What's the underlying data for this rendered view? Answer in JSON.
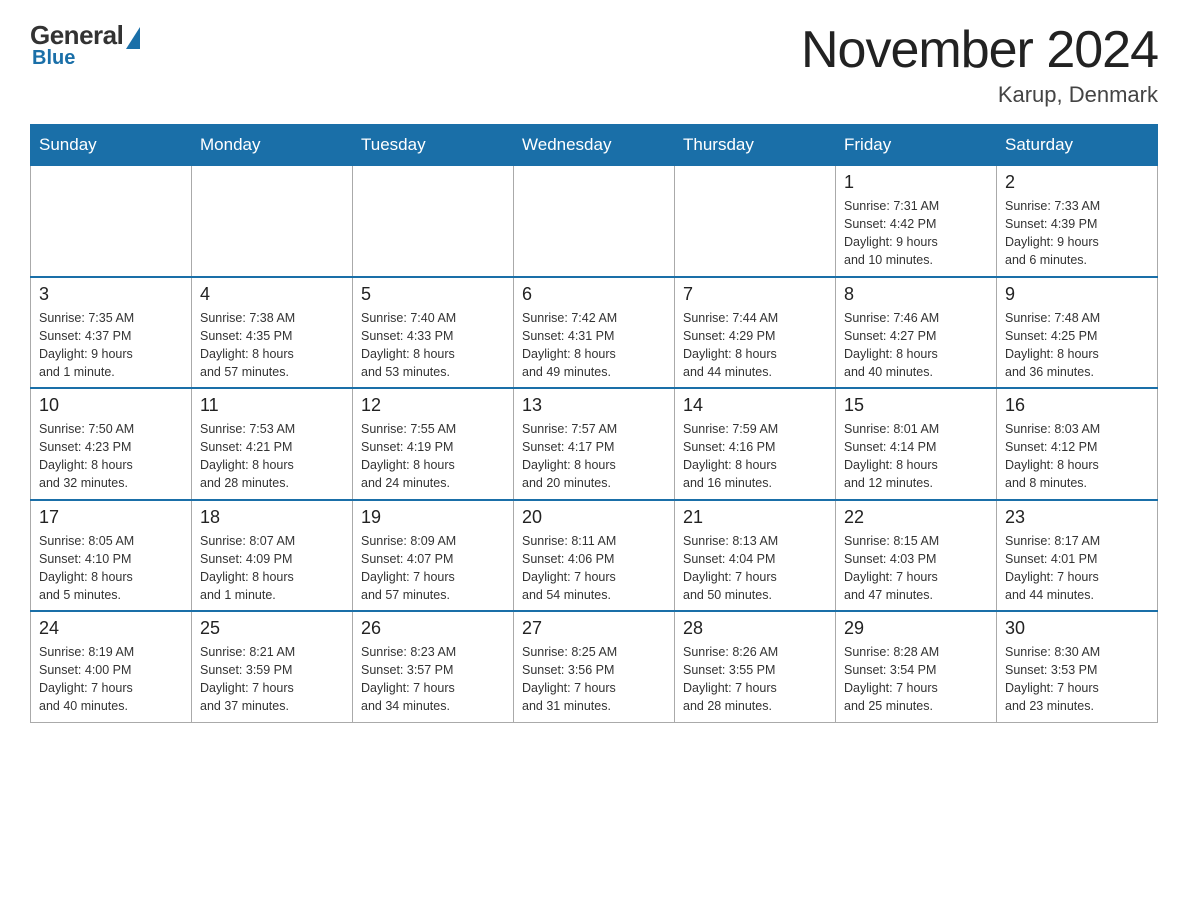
{
  "header": {
    "logo_general": "General",
    "logo_blue": "Blue",
    "month_title": "November 2024",
    "location": "Karup, Denmark"
  },
  "weekdays": [
    "Sunday",
    "Monday",
    "Tuesday",
    "Wednesday",
    "Thursday",
    "Friday",
    "Saturday"
  ],
  "weeks": [
    [
      {
        "day": "",
        "info": ""
      },
      {
        "day": "",
        "info": ""
      },
      {
        "day": "",
        "info": ""
      },
      {
        "day": "",
        "info": ""
      },
      {
        "day": "",
        "info": ""
      },
      {
        "day": "1",
        "info": "Sunrise: 7:31 AM\nSunset: 4:42 PM\nDaylight: 9 hours\nand 10 minutes."
      },
      {
        "day": "2",
        "info": "Sunrise: 7:33 AM\nSunset: 4:39 PM\nDaylight: 9 hours\nand 6 minutes."
      }
    ],
    [
      {
        "day": "3",
        "info": "Sunrise: 7:35 AM\nSunset: 4:37 PM\nDaylight: 9 hours\nand 1 minute."
      },
      {
        "day": "4",
        "info": "Sunrise: 7:38 AM\nSunset: 4:35 PM\nDaylight: 8 hours\nand 57 minutes."
      },
      {
        "day": "5",
        "info": "Sunrise: 7:40 AM\nSunset: 4:33 PM\nDaylight: 8 hours\nand 53 minutes."
      },
      {
        "day": "6",
        "info": "Sunrise: 7:42 AM\nSunset: 4:31 PM\nDaylight: 8 hours\nand 49 minutes."
      },
      {
        "day": "7",
        "info": "Sunrise: 7:44 AM\nSunset: 4:29 PM\nDaylight: 8 hours\nand 44 minutes."
      },
      {
        "day": "8",
        "info": "Sunrise: 7:46 AM\nSunset: 4:27 PM\nDaylight: 8 hours\nand 40 minutes."
      },
      {
        "day": "9",
        "info": "Sunrise: 7:48 AM\nSunset: 4:25 PM\nDaylight: 8 hours\nand 36 minutes."
      }
    ],
    [
      {
        "day": "10",
        "info": "Sunrise: 7:50 AM\nSunset: 4:23 PM\nDaylight: 8 hours\nand 32 minutes."
      },
      {
        "day": "11",
        "info": "Sunrise: 7:53 AM\nSunset: 4:21 PM\nDaylight: 8 hours\nand 28 minutes."
      },
      {
        "day": "12",
        "info": "Sunrise: 7:55 AM\nSunset: 4:19 PM\nDaylight: 8 hours\nand 24 minutes."
      },
      {
        "day": "13",
        "info": "Sunrise: 7:57 AM\nSunset: 4:17 PM\nDaylight: 8 hours\nand 20 minutes."
      },
      {
        "day": "14",
        "info": "Sunrise: 7:59 AM\nSunset: 4:16 PM\nDaylight: 8 hours\nand 16 minutes."
      },
      {
        "day": "15",
        "info": "Sunrise: 8:01 AM\nSunset: 4:14 PM\nDaylight: 8 hours\nand 12 minutes."
      },
      {
        "day": "16",
        "info": "Sunrise: 8:03 AM\nSunset: 4:12 PM\nDaylight: 8 hours\nand 8 minutes."
      }
    ],
    [
      {
        "day": "17",
        "info": "Sunrise: 8:05 AM\nSunset: 4:10 PM\nDaylight: 8 hours\nand 5 minutes."
      },
      {
        "day": "18",
        "info": "Sunrise: 8:07 AM\nSunset: 4:09 PM\nDaylight: 8 hours\nand 1 minute."
      },
      {
        "day": "19",
        "info": "Sunrise: 8:09 AM\nSunset: 4:07 PM\nDaylight: 7 hours\nand 57 minutes."
      },
      {
        "day": "20",
        "info": "Sunrise: 8:11 AM\nSunset: 4:06 PM\nDaylight: 7 hours\nand 54 minutes."
      },
      {
        "day": "21",
        "info": "Sunrise: 8:13 AM\nSunset: 4:04 PM\nDaylight: 7 hours\nand 50 minutes."
      },
      {
        "day": "22",
        "info": "Sunrise: 8:15 AM\nSunset: 4:03 PM\nDaylight: 7 hours\nand 47 minutes."
      },
      {
        "day": "23",
        "info": "Sunrise: 8:17 AM\nSunset: 4:01 PM\nDaylight: 7 hours\nand 44 minutes."
      }
    ],
    [
      {
        "day": "24",
        "info": "Sunrise: 8:19 AM\nSunset: 4:00 PM\nDaylight: 7 hours\nand 40 minutes."
      },
      {
        "day": "25",
        "info": "Sunrise: 8:21 AM\nSunset: 3:59 PM\nDaylight: 7 hours\nand 37 minutes."
      },
      {
        "day": "26",
        "info": "Sunrise: 8:23 AM\nSunset: 3:57 PM\nDaylight: 7 hours\nand 34 minutes."
      },
      {
        "day": "27",
        "info": "Sunrise: 8:25 AM\nSunset: 3:56 PM\nDaylight: 7 hours\nand 31 minutes."
      },
      {
        "day": "28",
        "info": "Sunrise: 8:26 AM\nSunset: 3:55 PM\nDaylight: 7 hours\nand 28 minutes."
      },
      {
        "day": "29",
        "info": "Sunrise: 8:28 AM\nSunset: 3:54 PM\nDaylight: 7 hours\nand 25 minutes."
      },
      {
        "day": "30",
        "info": "Sunrise: 8:30 AM\nSunset: 3:53 PM\nDaylight: 7 hours\nand 23 minutes."
      }
    ]
  ]
}
